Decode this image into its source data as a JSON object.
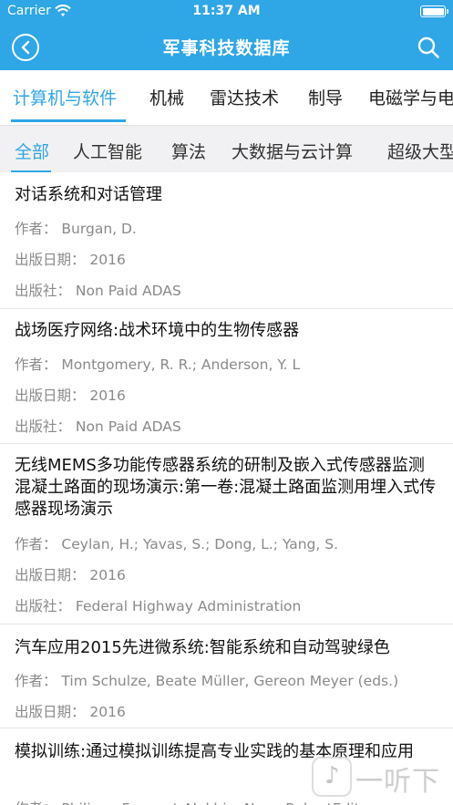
{
  "status_bar": {
    "carrier": "Carrier",
    "time": "11:37 AM"
  },
  "nav": {
    "title": "军事科技数据库",
    "back_icon": "back-arrow-circle-icon",
    "search_icon": "search-icon"
  },
  "colors": {
    "accent": "#2fa6e6",
    "meta_text": "#8a8a8a",
    "subtab_bg": "#f1f1f3"
  },
  "category_tabs": [
    {
      "label": "计算机与软件",
      "active": true
    },
    {
      "label": "机械",
      "active": false
    },
    {
      "label": "雷达技术",
      "active": false
    },
    {
      "label": "制导",
      "active": false
    },
    {
      "label": "电磁学与电",
      "active": false
    }
  ],
  "sub_tabs": [
    {
      "label": "全部",
      "active": true
    },
    {
      "label": "人工智能",
      "active": false
    },
    {
      "label": "算法",
      "active": false
    },
    {
      "label": "大数据与云计算",
      "active": false
    },
    {
      "label": "超级大型",
      "active": false
    }
  ],
  "items": [
    {
      "title": "对话系统和对话管理",
      "author": "作者：  Burgan, D.",
      "date": "出版日期：  2016",
      "publisher": "出版社：  Non Paid ADAS"
    },
    {
      "title": "战场医疗网络:战术环境中的生物传感器",
      "author": "作者：  Montgomery, R. R.; Anderson, Y. L",
      "date": "出版日期：  2016",
      "publisher": "出版社：  Non Paid ADAS"
    },
    {
      "title": "无线MEMS多功能传感器系统的研制及嵌入式传感器监测混凝土路面的现场演示:第一卷:混凝土路面监测用埋入式传感器现场演示",
      "author": "作者：  Ceylan, H.; Yavas, S.; Dong, L.; Yang, S.",
      "date": "出版日期：  2016",
      "publisher": "出版社：  Federal Highway Administration"
    },
    {
      "title": "汽车应用2015先进微系统:智能系统和自动驾驶绿色",
      "author": "作者：  Tim Schulze, Beate Müller, Gereon Meyer (eds.)",
      "date": "出版日期：  2016"
    },
    {
      "title": "模拟训练:通过模拟训练提高专业实践的基本原理和应用",
      "author": "作者：  Philippe Fauquet-AlekhineNone RobertEditors"
    }
  ],
  "watermark": {
    "text": "一听下载"
  }
}
